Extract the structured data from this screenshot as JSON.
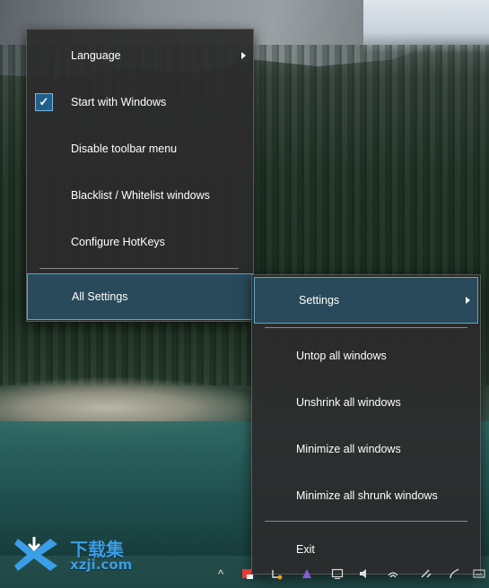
{
  "menu_primary": {
    "items": [
      {
        "label": "Language",
        "has_submenu": true
      },
      {
        "label": "Start with Windows",
        "checked": true
      },
      {
        "label": "Disable toolbar menu"
      },
      {
        "label": "Blacklist / Whitelist windows"
      },
      {
        "label": "Configure HotKeys"
      },
      {
        "label": "All Settings",
        "highlighted": true
      }
    ]
  },
  "menu_secondary": {
    "items": [
      {
        "label": "Settings",
        "has_submenu": true,
        "highlighted": true
      },
      {
        "label": "Untop all windows"
      },
      {
        "label": "Unshrink all windows"
      },
      {
        "label": "Minimize all windows"
      },
      {
        "label": "Minimize all shrunk windows"
      },
      {
        "label": "Exit"
      }
    ]
  },
  "checkmark": "✓",
  "watermark": {
    "title": "下载集",
    "url": "xzji.com"
  },
  "colors": {
    "menu_bg": "#2b2b2b",
    "highlight": "#5ea6c8",
    "checkbox": "#1f5f8a",
    "watermark": "#3b9ee6"
  },
  "tray_icons": [
    "chevron-up-icon",
    "app-icon",
    "update-icon",
    "pen-icon",
    "monitor-icon",
    "volume-icon",
    "network-icon",
    "clipboard-icon",
    "keyboard-icon"
  ]
}
